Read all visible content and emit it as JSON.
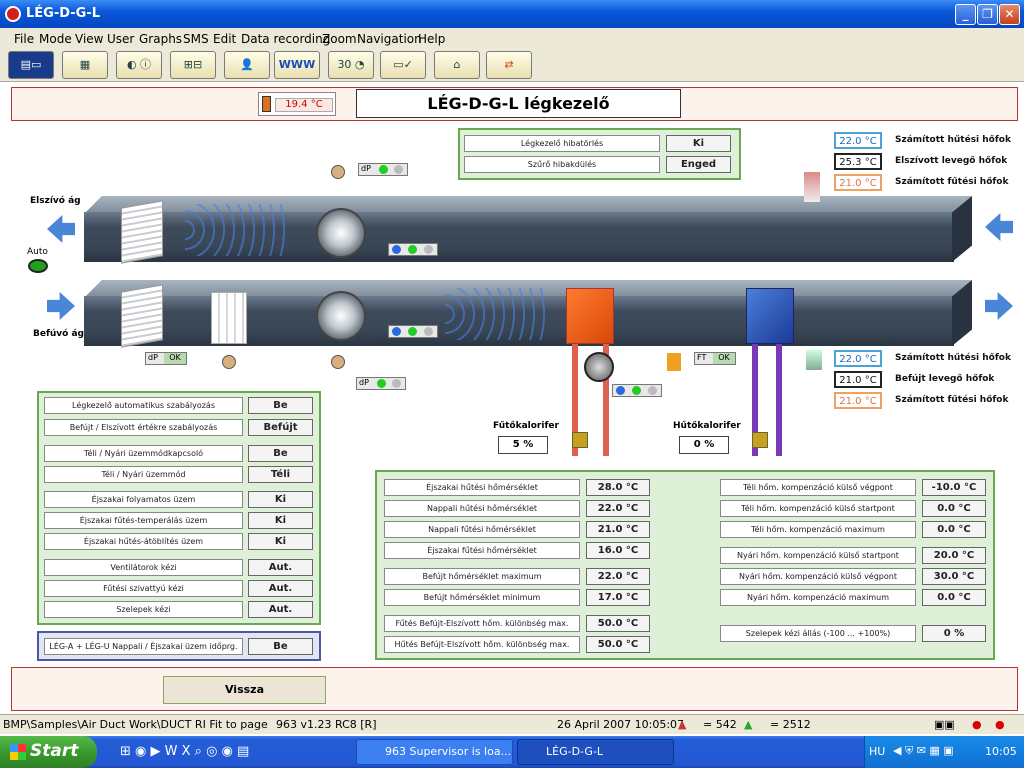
{
  "window": {
    "title": "LÉG-D-G-L",
    "btn_min": "_",
    "btn_max": "❐",
    "btn_close": "✕"
  },
  "menu": [
    "File",
    "Mode",
    "View",
    "User",
    "Graphs",
    "SMS",
    "Edit",
    "Data recording",
    "Zoom",
    "Navigation",
    "Help"
  ],
  "toolbar": {
    "www": "WWW",
    "calendar": "30"
  },
  "banner": {
    "outdoor_temp": "19.4 °C",
    "title": "LÉG-D-G-L légkezelő"
  },
  "alarm_panel": [
    {
      "label": "Légkezelő hibatörlés",
      "value": "Ki"
    },
    {
      "label": "Szűrő hibakdülés",
      "value": "Enged"
    }
  ],
  "top_temps": [
    {
      "value": "22.0 °C",
      "label": "Számított hűtési hőfok",
      "kind": "cool"
    },
    {
      "value": "25.3 °C",
      "label": "Elszívott levegő hőfok",
      "kind": "black"
    },
    {
      "value": "21.0 °C",
      "label": "Számított fűtési hőfok",
      "kind": "heat"
    }
  ],
  "bottom_temps": [
    {
      "value": "22.0 °C",
      "label": "Számított hűtési hőfok",
      "kind": "cool"
    },
    {
      "value": "21.0 °C",
      "label": "Befújt levegő hőfok",
      "kind": "black"
    },
    {
      "value": "21.0 °C",
      "label": "Számított fűtési hőfok",
      "kind": "heat"
    }
  ],
  "diagram": {
    "exhaust_label": "Elszívó ág",
    "supply_label": "Befúvó ág",
    "auto_label": "Auto",
    "dp": "dP",
    "ok": "OK",
    "ft": "FT",
    "heater_label": "Fűtőkalorifer",
    "heater_value": "5 %",
    "cooler_label": "Hűtőkalorifer",
    "cooler_value": "0 %"
  },
  "left_panel": [
    {
      "label": "Légkezelő automatikus szabályozás",
      "value": "Be"
    },
    {
      "label": "Befújt / Elszívott értékre szabályozás",
      "value": "Befújt"
    },
    {
      "label": "Téli / Nyári üzemmódkapcsoló",
      "value": "Be"
    },
    {
      "label": "Téli / Nyári üzemmód",
      "value": "Téli"
    },
    {
      "label": "Éjszakai folyamatos üzem",
      "value": "Ki"
    },
    {
      "label": "Éjszakai fűtés-temperálás üzem",
      "value": "Ki"
    },
    {
      "label": "Éjszakai hűtés-átöblítés üzem",
      "value": "Ki"
    },
    {
      "label": "Ventilátorok kézi",
      "value": "Aut."
    },
    {
      "label": "Fűtési szivattyú kézi",
      "value": "Aut."
    },
    {
      "label": "Szelepek kézi",
      "value": "Aut."
    }
  ],
  "program_row": {
    "label": "LÉG-A + LÉG-U Nappali / Éjszakai üzem időprg.",
    "value": "Be"
  },
  "setpoints_left": [
    {
      "label": "Éjszakai hűtési hőmérséklet",
      "value": "28.0 °C"
    },
    {
      "label": "Nappali hűtési hőmérséklet",
      "value": "22.0 °C"
    },
    {
      "label": "Nappali fűtési hőmérséklet",
      "value": "21.0 °C"
    },
    {
      "label": "Éjszakai fűtési hőmérséklet",
      "value": "16.0 °C"
    },
    {
      "label": "Befújt hőmérséklet maximum",
      "value": "22.0 °C"
    },
    {
      "label": "Befújt hőmérséklet minimum",
      "value": "17.0 °C"
    },
    {
      "label": "Fűtés Befújt-Elszívott hőm. különbség max.",
      "value": "50.0 °C"
    },
    {
      "label": "Hűtés Befújt-Elszívott hőm. különbség max.",
      "value": "50.0 °C"
    }
  ],
  "setpoints_right": [
    {
      "label": "Téli hőm. kompenzáció külső végpont",
      "value": "-10.0 °C"
    },
    {
      "label": "Téli hőm. kompenzáció külső startpont",
      "value": "0.0 °C"
    },
    {
      "label": "Téli hőm. kompenzáció maximum",
      "value": "0.0 °C"
    },
    {
      "label": "Nyári hőm. kompenzáció külső startpont",
      "value": "20.0 °C"
    },
    {
      "label": "Nyári hőm. kompenzáció külső végpont",
      "value": "30.0 °C"
    },
    {
      "label": "Nyári hőm. kompenzáció maximum",
      "value": "0.0 °C"
    },
    {
      "label": "Szelepek kézi állás (-100 ... +100%)",
      "value": "0 %"
    }
  ],
  "back_button": "Vissza",
  "statusbar": {
    "path": "BMP\\Samples\\Air Duct Work\\DUCT RI Fit to page",
    "version": "963 v1.23 RC8 [R]",
    "date": "26 April 2007 10:05:07",
    "count1": "= 542",
    "count2": "= 2512"
  },
  "taskbar": {
    "start": "Start",
    "task1": "963 Supervisor is loa...",
    "task2": "LÉG-D-G-L",
    "lang": "HU",
    "clock": "10:05"
  },
  "colors": {
    "accent_border": "#b33",
    "panel_green": "#6aa84f",
    "cool": "#4aa3d8",
    "heat": "#f0a060"
  }
}
